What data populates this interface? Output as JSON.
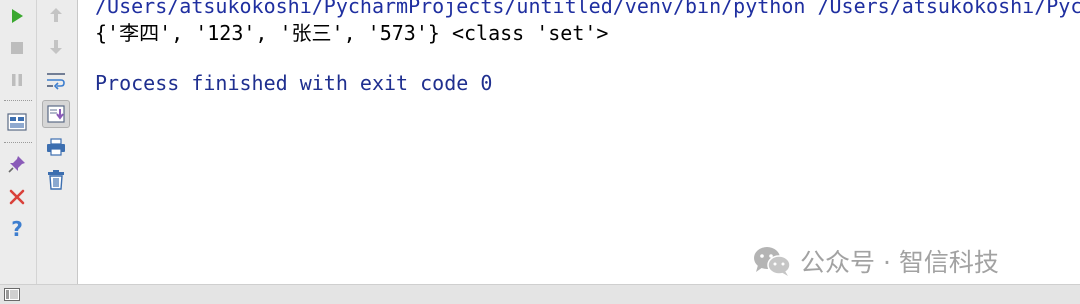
{
  "console": {
    "command_line": "/Users/atsukokoshi/PycharmProjects/untitled/venv/bin/python /Users/atsukokoshi/PycharmProjects/untitled",
    "output_line": "{'李四', '123', '张三', '573'} <class 'set'>",
    "exit_line": "Process finished with exit code 0"
  },
  "toolbar": {
    "left_icons": [
      "run-icon",
      "stop-icon",
      "pause-icon",
      "layout-icon",
      "pin-icon",
      "close-icon",
      "help-icon"
    ],
    "right_icons": [
      "up-arrow-icon",
      "down-arrow-icon",
      "soft-wrap-icon",
      "scroll-to-end-icon",
      "print-icon",
      "trash-icon"
    ]
  },
  "watermark": {
    "text": "公众号 · 智信科技"
  },
  "colors": {
    "command_text": "#1f2fa0",
    "output_text": "#000000",
    "exit_text": "#1f2f8f",
    "run_green": "#3aa82f",
    "close_red": "#d9413a",
    "help_blue": "#3d7ecf",
    "watermark_gray": "#a2a2a2"
  }
}
